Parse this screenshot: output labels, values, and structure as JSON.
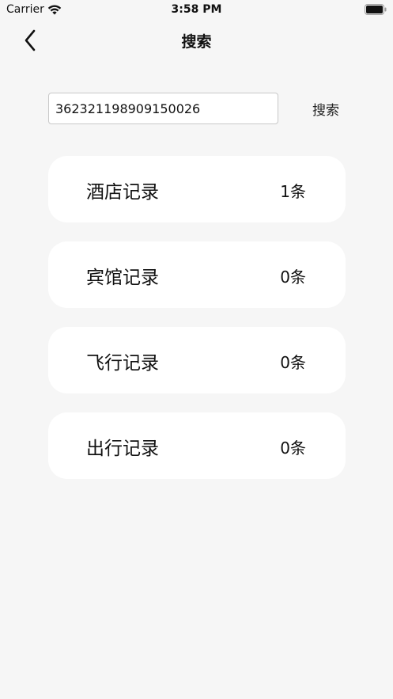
{
  "status_bar": {
    "carrier": "Carrier",
    "time": "3:58 PM",
    "wifi_icon": "wifi-icon",
    "battery_icon": "battery-icon"
  },
  "nav": {
    "title": "搜索",
    "back_icon": "chevron-left-icon"
  },
  "search": {
    "value": "362321198909150026",
    "button_label": "搜索"
  },
  "records": [
    {
      "label": "酒店记录",
      "count": "1条"
    },
    {
      "label": "宾馆记录",
      "count": "0条"
    },
    {
      "label": "飞行记录",
      "count": "0条"
    },
    {
      "label": "出行记录",
      "count": "0条"
    }
  ]
}
